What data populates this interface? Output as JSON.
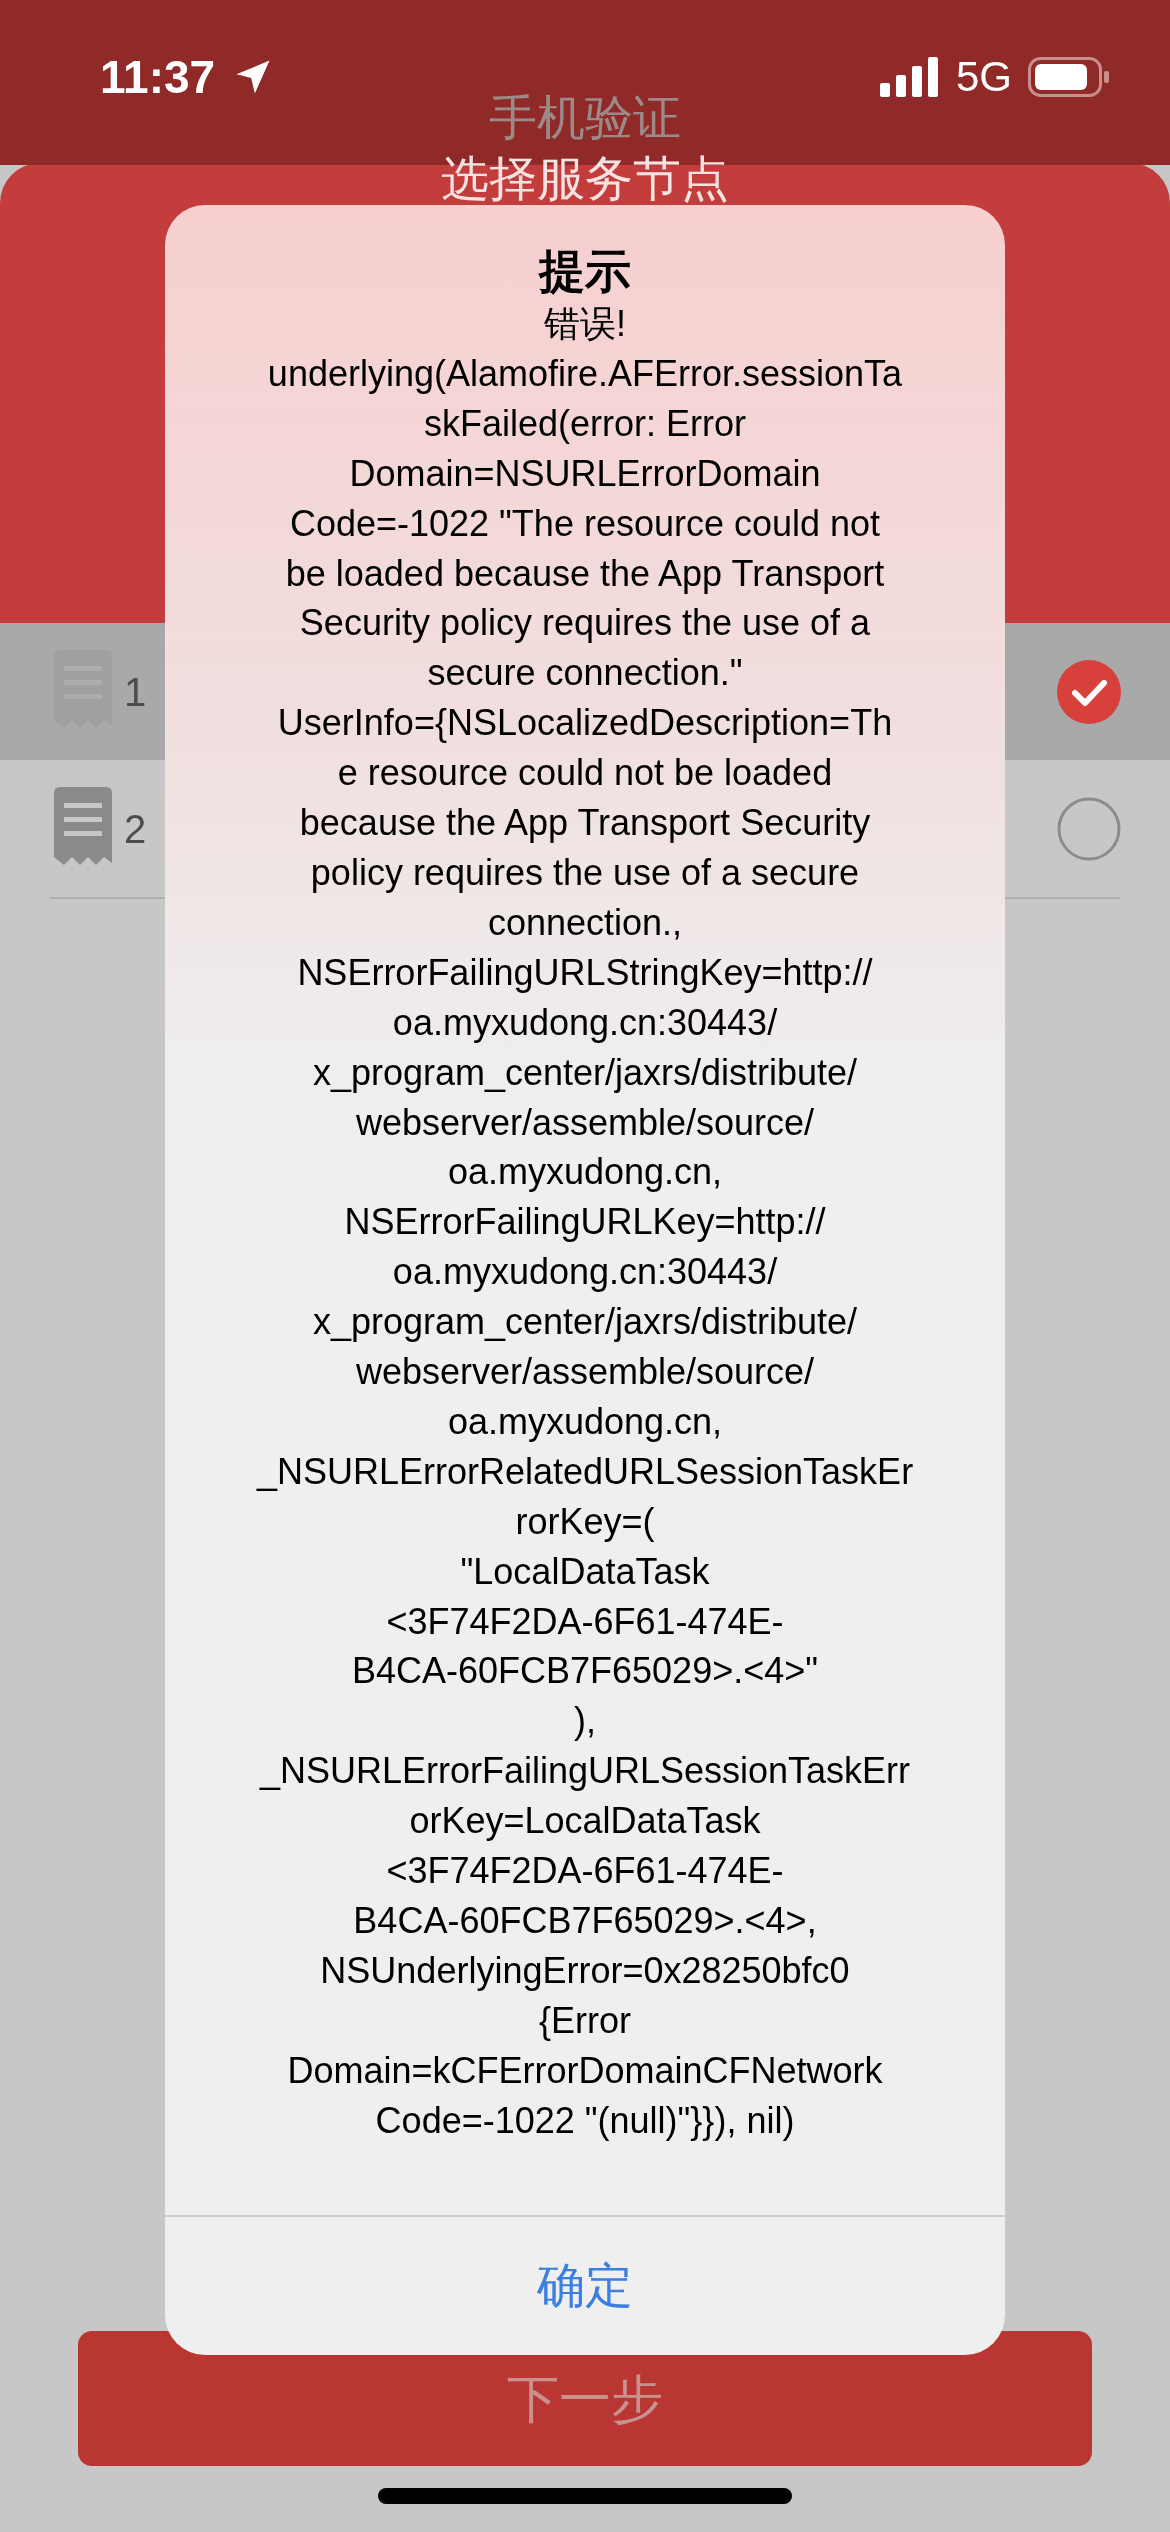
{
  "status_bar": {
    "time": "11:37",
    "network": "5G"
  },
  "header": {
    "title": "手机验证"
  },
  "panel": {
    "title": "选择服务节点"
  },
  "nodes": [
    {
      "label": "1",
      "selected": true
    },
    {
      "label": "2",
      "selected": false
    }
  ],
  "next_button": {
    "label": "下一步"
  },
  "alert": {
    "title": "提示",
    "message": "错误!\nunderlying(Alamofire.AFError.sessionTa\nskFailed(error: Error\nDomain=NSURLErrorDomain\nCode=-1022 \"The resource could not\nbe loaded because the App Transport\nSecurity policy requires the use of a\nsecure connection.\"\nUserInfo={NSLocalizedDescription=Th\ne resource could not be loaded\nbecause the App Transport Security\npolicy requires the use of a secure\nconnection.,\nNSErrorFailingURLStringKey=http://\noa.myxudong.cn:30443/\nx_program_center/jaxrs/distribute/\nwebserver/assemble/source/\noa.myxudong.cn,\nNSErrorFailingURLKey=http://\noa.myxudong.cn:30443/\nx_program_center/jaxrs/distribute/\nwebserver/assemble/source/\noa.myxudong.cn,\n_NSURLErrorRelatedURLSessionTaskEr\nrorKey=(\n\"LocalDataTask\n<3F74F2DA-6F61-474E-\nB4CA-60FCB7F65029>.<4>\"\n),\n_NSURLErrorFailingURLSessionTaskErr\norKey=LocalDataTask\n<3F74F2DA-6F61-474E-\nB4CA-60FCB7F65029>.<4>,\nNSUnderlyingError=0x28250bfc0\n{Error\nDomain=kCFErrorDomainCFNetwork\nCode=-1022 \"(null)\"}}), nil)",
    "button": "确定"
  }
}
